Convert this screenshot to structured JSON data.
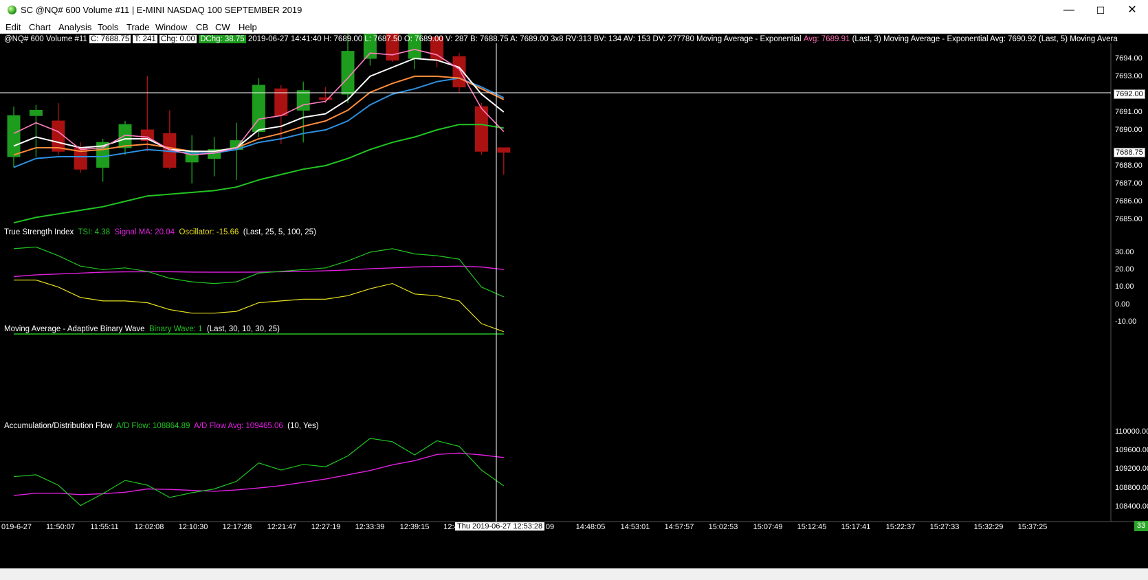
{
  "window": {
    "title": "SC @NQ#  600 Volume  #11 | E-MINI NASDAQ 100 SEPTEMBER 2019",
    "minimize": "—",
    "maximize": "☐",
    "close": "✕"
  },
  "menu": [
    "Edit",
    "Chart",
    "Analysis",
    "Tools",
    "Trade",
    "Window",
    "CB",
    "CW",
    "Help"
  ],
  "infobar": {
    "symbol": "@NQ#  600 Volume  #11",
    "close": "C: 7688.75",
    "trades": "T: 241",
    "chg": "Chg: 0.00",
    "dchg": "DChg: 38.75",
    "rest": "2019-06-27 14:41:40 H: 7689.00 L: 7687.50 O: 7689.00 V: 287 B: 7688.75 A: 7689.00 3x8 RV:313 BV: 134 AV: 153 DV: 277780 Moving Average - Exponential",
    "ema1_avg": "Avg: 7689.91",
    "ema1_params": "(Last, 3)  Moving Average - Exponential  Avg: 7690.92  (Last, 5)  Moving Avera"
  },
  "price_axis": [
    "7694.00",
    "7693.00",
    "7692.00",
    "7691.00",
    "7690.00",
    "7689.00",
    "7688.00",
    "7687.00",
    "7686.00",
    "7685.00"
  ],
  "current_price": "7688.75",
  "crosshair_price": "7692.00",
  "tsi": {
    "title": "True Strength Index",
    "tsi": "TSI: 4.38",
    "signal": "Signal MA: 20.04",
    "osc": "Oscillator: -15.66",
    "params": "(Last, 25, 5, 100, 25)",
    "axis": [
      "30.00",
      "20.00",
      "10.00",
      "0.00",
      "-10.00"
    ]
  },
  "abw": {
    "title": "Moving Average - Adaptive Binary Wave",
    "wave": "Binary Wave: 1",
    "params": "(Last, 30, 10, 30, 25)"
  },
  "adf": {
    "title": "Accumulation/Distribution Flow",
    "flow": "A/D Flow: 108864.89",
    "avg": "A/D Flow Avg: 109465.06",
    "params": "(10, Yes)",
    "axis": [
      "110000.00",
      "109600.00",
      "109200.00",
      "108800.00",
      "108400.00"
    ]
  },
  "time_axis": [
    "019-6-27",
    "11:50:07",
    "11:55:11",
    "12:02:08",
    "12:10:30",
    "12:17:28",
    "12:21:47",
    "12:27:19",
    "12:33:39",
    "12:39:15",
    "12:4",
    "09",
    "14:48:05",
    "14:53:01",
    "14:57:57",
    "15:02:53",
    "15:07:49",
    "15:12:45",
    "15:17:41",
    "15:22:37",
    "15:27:33",
    "15:32:29",
    "15:37:25"
  ],
  "crosshair_time": "Thu 2019-06-27  12:53:28",
  "badge": "33",
  "colors": {
    "up": "#1e9c1e",
    "down": "#aa1212",
    "white": "#ffffff",
    "pink": "#ff7fc0",
    "orange": "#ff8c3c",
    "blue": "#2e90e0",
    "green": "#22c422",
    "magenta": "#e020e0",
    "yellow": "#e8e020",
    "ema_avg_text": "#ff6eb4"
  },
  "chart_data": {
    "type": "candlestick",
    "candles": [
      {
        "o": 7688.5,
        "c": 7690.8,
        "h": 7691.3,
        "l": 7687.9
      },
      {
        "o": 7690.8,
        "c": 7691.1,
        "h": 7691.4,
        "l": 7688.5
      },
      {
        "o": 7690.5,
        "c": 7688.8,
        "h": 7691.5,
        "l": 7688.6
      },
      {
        "o": 7689.0,
        "c": 7687.8,
        "h": 7689.3,
        "l": 7687.6
      },
      {
        "o": 7687.9,
        "c": 7689.3,
        "h": 7689.5,
        "l": 7687.1
      },
      {
        "o": 7689.0,
        "c": 7690.3,
        "h": 7690.5,
        "l": 7688.6
      },
      {
        "o": 7690.0,
        "c": 7689.4,
        "h": 7693.0,
        "l": 7688.8
      },
      {
        "o": 7689.8,
        "c": 7687.9,
        "h": 7691.1,
        "l": 7687.8
      },
      {
        "o": 7688.2,
        "c": 7688.8,
        "h": 7689.7,
        "l": 7687.0
      },
      {
        "o": 7688.4,
        "c": 7688.9,
        "h": 7689.6,
        "l": 7687.4
      },
      {
        "o": 7688.9,
        "c": 7689.4,
        "h": 7690.4,
        "l": 7687.2
      },
      {
        "o": 7689.9,
        "c": 7692.5,
        "h": 7692.9,
        "l": 7689.6
      },
      {
        "o": 7692.3,
        "c": 7690.8,
        "h": 7692.5,
        "l": 7689.2
      },
      {
        "o": 7691.1,
        "c": 7692.2,
        "h": 7692.7,
        "l": 7689.3
      },
      {
        "o": 7691.8,
        "c": 7691.7,
        "h": 7692.4,
        "l": 7691.5
      },
      {
        "o": 7692.0,
        "c": 7694.4,
        "h": 7696.2,
        "l": 7691.5
      },
      {
        "o": 7694.0,
        "c": 7695.9,
        "h": 7697.0,
        "l": 7693.6
      },
      {
        "o": 7695.4,
        "c": 7693.9,
        "h": 7695.9,
        "l": 7693.8
      },
      {
        "o": 7694.0,
        "c": 7695.8,
        "h": 7696.0,
        "l": 7693.4
      },
      {
        "o": 7695.2,
        "c": 7693.9,
        "h": 7695.2,
        "l": 7693.5
      },
      {
        "o": 7694.1,
        "c": 7692.4,
        "h": 7694.3,
        "l": 7692.1
      },
      {
        "o": 7691.3,
        "c": 7688.8,
        "h": 7691.5,
        "l": 7688.6
      },
      {
        "o": 7689.0,
        "c": 7688.75,
        "h": 7689.0,
        "l": 7687.5
      }
    ],
    "ema_pink": [
      7689.8,
      7690.4,
      7689.9,
      7688.9,
      7689.0,
      7689.7,
      7689.6,
      7688.9,
      7688.6,
      7688.7,
      7689.0,
      7690.6,
      7690.8,
      7691.4,
      7691.6,
      7692.9,
      7694.3,
      7694.2,
      7694.5,
      7694.2,
      7693.4,
      7691.2,
      7689.9
    ],
    "ema_white": [
      7689.1,
      7689.6,
      7689.3,
      7689.0,
      7689.1,
      7689.5,
      7689.5,
      7688.9,
      7688.8,
      7688.8,
      7689.0,
      7690.0,
      7690.2,
      7690.7,
      7690.9,
      7691.7,
      7693.0,
      7693.5,
      7694.0,
      7693.9,
      7693.5,
      7692.0,
      7691.0
    ],
    "ema_orange": [
      7688.6,
      7689.0,
      7689.0,
      7688.8,
      7688.9,
      7689.1,
      7689.2,
      7689.0,
      7688.8,
      7688.8,
      7689.0,
      7689.5,
      7689.8,
      7690.2,
      7690.5,
      7691.1,
      7692.1,
      7692.6,
      7693.0,
      7693.0,
      7692.9,
      7692.3,
      7691.7
    ],
    "ema_blue": [
      7687.9,
      7688.4,
      7688.5,
      7688.5,
      7688.5,
      7688.7,
      7688.9,
      7688.8,
      7688.7,
      7688.7,
      7688.9,
      7689.3,
      7689.5,
      7689.8,
      7690.0,
      7690.5,
      7691.4,
      7692.0,
      7692.3,
      7692.7,
      7692.9,
      7692.4,
      7691.8
    ],
    "ema_green": [
      7684.8,
      7685.1,
      7685.3,
      7685.5,
      7685.7,
      7686.0,
      7686.3,
      7686.4,
      7686.5,
      7686.6,
      7686.8,
      7687.2,
      7687.5,
      7687.8,
      7688.0,
      7688.4,
      7688.9,
      7689.3,
      7689.6,
      7690.0,
      7690.3,
      7690.3,
      7690.1
    ],
    "tsi_green": [
      32,
      33,
      28,
      22,
      20,
      21,
      19,
      15,
      13,
      12,
      13,
      18,
      19,
      20,
      21,
      25,
      30,
      32,
      29,
      28,
      26,
      10,
      4.38
    ],
    "tsi_magenta": [
      16,
      17,
      17.5,
      18,
      18.5,
      18.7,
      18.8,
      18.8,
      18.6,
      18.5,
      18.5,
      18.6,
      18.8,
      19.0,
      19.3,
      19.8,
      20.5,
      21,
      21.5,
      21.8,
      22,
      21.5,
      20.04
    ],
    "tsi_yellow": [
      14,
      14,
      10,
      4,
      2,
      2,
      1,
      -3,
      -5,
      -5,
      -4,
      1,
      2,
      3,
      3,
      5,
      9,
      12,
      6,
      5,
      2,
      -11,
      -15.66
    ],
    "adf_green": [
      109060,
      109100,
      108880,
      108450,
      108700,
      108980,
      108880,
      108620,
      108720,
      108800,
      108960,
      109350,
      109200,
      109320,
      109270,
      109500,
      109870,
      109800,
      109520,
      109820,
      109700,
      109200,
      108864.89
    ],
    "adf_magenta": [
      108660,
      108710,
      108710,
      108680,
      108700,
      108730,
      108800,
      108790,
      108770,
      108750,
      108780,
      108820,
      108870,
      108940,
      109010,
      109100,
      109190,
      109310,
      109400,
      109530,
      109560,
      109520,
      109465.06
    ]
  }
}
